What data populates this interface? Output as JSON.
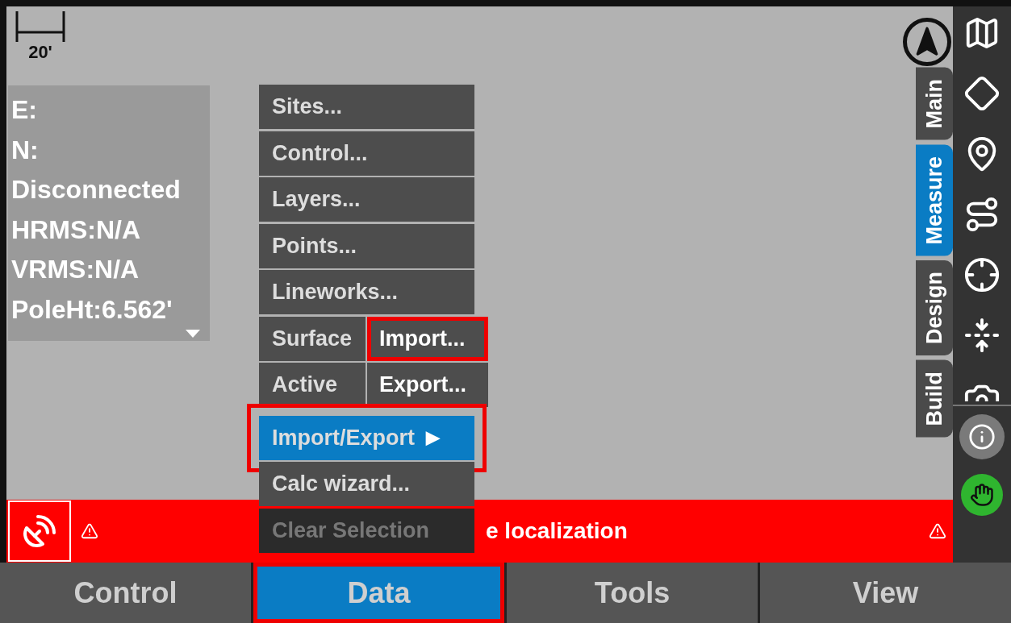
{
  "map": {
    "scale": "20'",
    "readout": [
      "E:",
      "N:",
      "Disconnected",
      "HRMS:N/A",
      "VRMS:N/A",
      "PoleHt:6.562'"
    ]
  },
  "side_tabs": [
    {
      "label": "Main",
      "selected": false
    },
    {
      "label": "Measure",
      "selected": true
    },
    {
      "label": "Design",
      "selected": false
    },
    {
      "label": "Build",
      "selected": false
    }
  ],
  "menu": {
    "items": [
      {
        "label": "Sites...",
        "selected": false,
        "disabled": false,
        "highlighted": false
      },
      {
        "label": "Control...",
        "selected": false,
        "disabled": false,
        "highlighted": false
      },
      {
        "label": "Layers...",
        "selected": false,
        "disabled": false,
        "highlighted": false
      },
      {
        "label": "Points...",
        "selected": false,
        "disabled": false,
        "highlighted": false
      },
      {
        "label": "Lineworks...",
        "selected": false,
        "disabled": false,
        "highlighted": false
      },
      {
        "label": "Surface",
        "selected": false,
        "disabled": false,
        "highlighted": false
      },
      {
        "label": "Active",
        "selected": false,
        "disabled": false,
        "highlighted": false
      },
      {
        "label": "Import/Export",
        "arrow": "▶",
        "selected": true,
        "disabled": false,
        "highlighted": true
      },
      {
        "label": "Calc wizard...",
        "selected": false,
        "disabled": false,
        "highlighted": false
      },
      {
        "label": "Clear Selection",
        "selected": false,
        "disabled": true,
        "highlighted": false
      }
    ],
    "submenu": [
      {
        "label": "Import...",
        "highlighted": true
      },
      {
        "label": "Export...",
        "highlighted": false
      }
    ]
  },
  "alert": {
    "text": "e localization"
  },
  "bottom_tabs": [
    {
      "label": "Control",
      "selected": false,
      "highlighted": false
    },
    {
      "label": "Data",
      "selected": true,
      "highlighted": true
    },
    {
      "label": "Tools",
      "selected": false,
      "highlighted": false
    },
    {
      "label": "View",
      "selected": false,
      "highlighted": false
    }
  ]
}
